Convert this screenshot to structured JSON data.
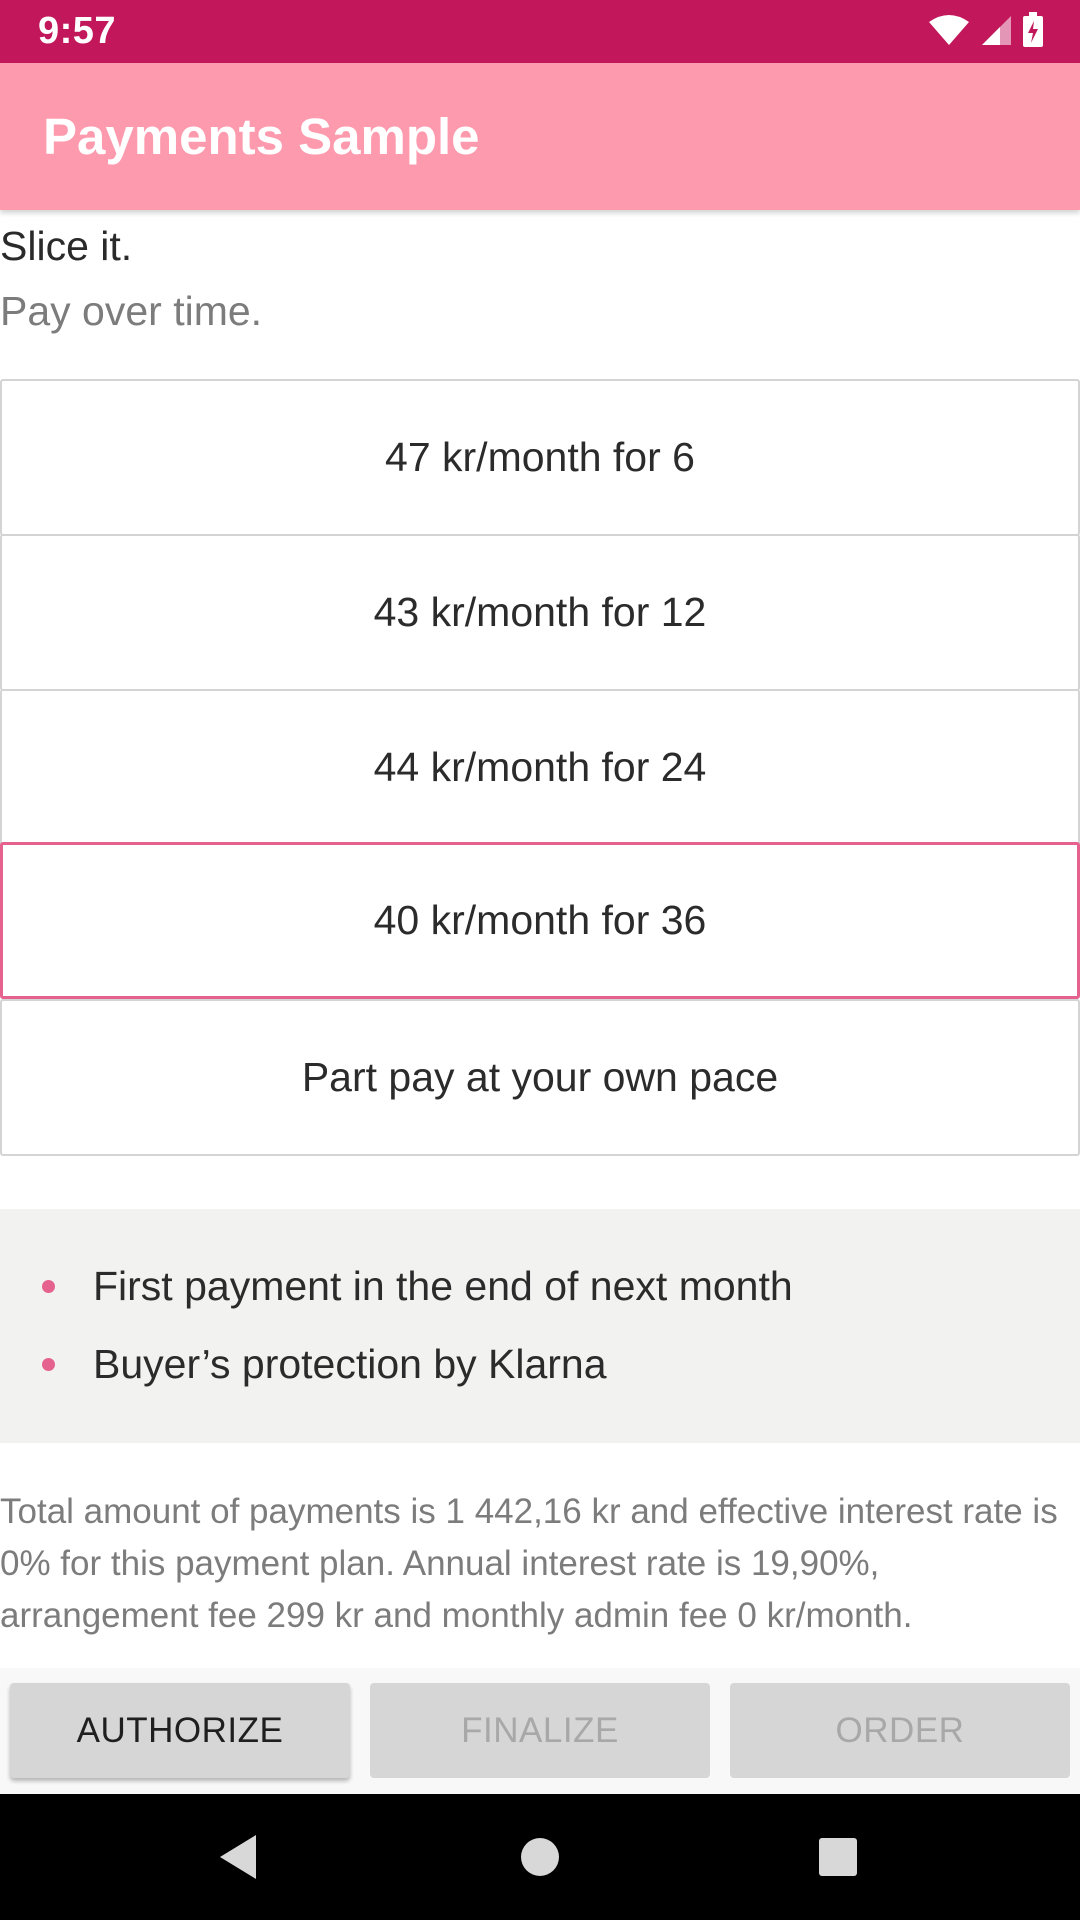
{
  "status_bar": {
    "time": "9:57",
    "icons": [
      "wifi-icon",
      "cell-signal-icon",
      "battery-charging-icon"
    ]
  },
  "app_bar": {
    "title": "Payments Sample"
  },
  "header": {
    "title": "Slice it.",
    "subtitle": "Pay over time."
  },
  "payment_options": [
    {
      "label": "47 kr/month for 6",
      "selected": false
    },
    {
      "label": "43 kr/month for 12",
      "selected": false
    },
    {
      "label": "44 kr/month for 24",
      "selected": false
    },
    {
      "label": "40 kr/month for 36",
      "selected": true
    },
    {
      "label": "Part pay at your own pace",
      "selected": false
    }
  ],
  "info": {
    "bullets": [
      "First payment in the end of next month",
      "Buyer’s protection by Klarna"
    ]
  },
  "disclaimer": "Total amount of payments is 1 442,16 kr and effective interest rate is 0% for this payment plan. Annual interest rate is 19,90%, arrangement fee 299 kr and monthly admin fee 0 kr/month.",
  "actions": {
    "authorize": {
      "label": "AUTHORIZE",
      "enabled": true
    },
    "finalize": {
      "label": "FINALIZE",
      "enabled": false
    },
    "order": {
      "label": "ORDER",
      "enabled": false
    }
  },
  "nav": {
    "back": "back-icon",
    "home": "home-icon",
    "recents": "recents-icon"
  },
  "colors": {
    "status_bar": "#c2185b",
    "app_bar": "#fe9aad",
    "accent": "#e5628f",
    "info_bg": "#f2f2f1"
  }
}
